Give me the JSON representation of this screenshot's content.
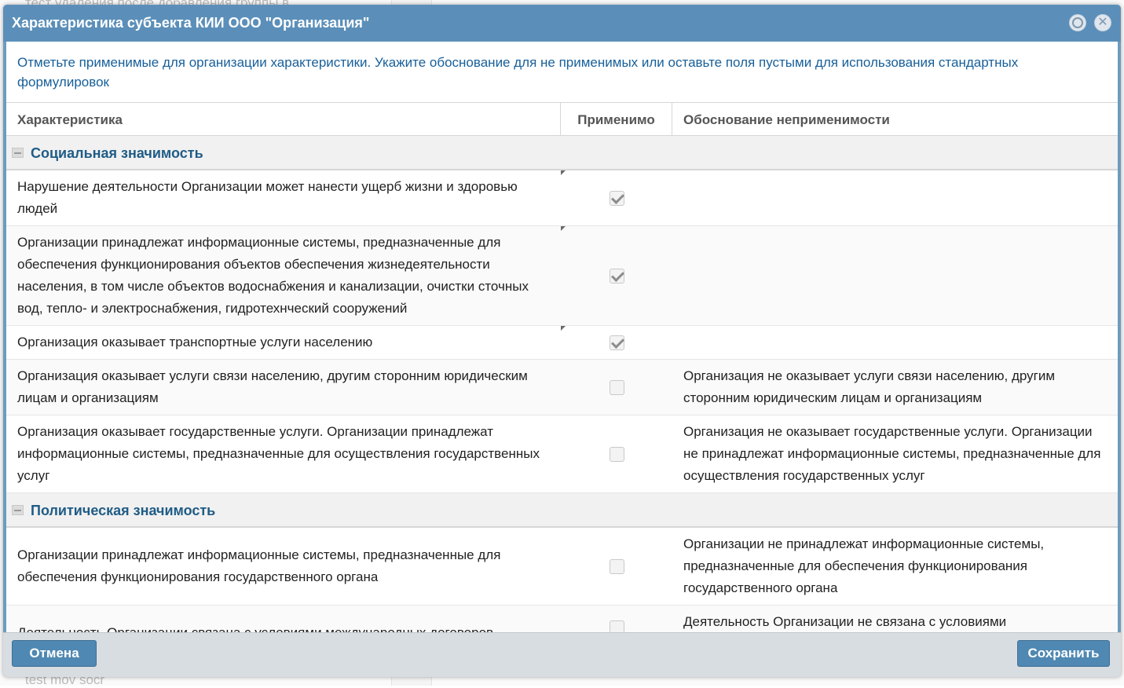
{
  "background": {
    "top_text": "тест удаления после добавления группы в",
    "bottom_text": "test mov socr"
  },
  "dialog": {
    "title": "Характеристика субъекта КИИ ООО \"Организация\"",
    "close_symbol": "✕",
    "hint": "Отметьте применимые для организации характеристики. Укажите обоснование для не применимых или оставьте поля пустыми для использования стандартных формулировок"
  },
  "grid": {
    "columns": [
      "Характеристика",
      "Применимо",
      "Обоснование неприменимости"
    ],
    "groups": [
      {
        "title": "Социальная значимость",
        "rows": [
          {
            "characteristic": "Нарушение деятельности Организации может нанести ущерб жизни и здоровью людей",
            "applicable": true,
            "justification": ""
          },
          {
            "characteristic": "Организации принадлежат информационные системы, предназначенные для обеспечения функционирования объектов обеспечения жизнедеятельности населения, в том числе объектов водоснабжения и канализации, очистки сточных вод, тепло- и электроснабжения, гидротехнческий сооружений",
            "applicable": true,
            "justification": ""
          },
          {
            "characteristic": "Организация оказывает транспортные услуги населению",
            "applicable": true,
            "justification": ""
          },
          {
            "characteristic": "Организация оказывает услуги связи населению, другим сторонним юридическим лицам и организациям",
            "applicable": false,
            "justification": "Организация не оказывает услуги связи населению, другим сторонним юридическим лицам и организациям"
          },
          {
            "characteristic": "Организация оказывает государственные услуги. Организации принадлежат информационные системы, предназначенные для осуществления государственных услуг",
            "applicable": false,
            "justification": "Организация не оказывает государственные услуги. Организации не принадлежат информационные системы, предназначенные для осуществления государственных услуг"
          }
        ]
      },
      {
        "title": "Политическая значимость",
        "rows": [
          {
            "characteristic": "Организации принадлежат информационные системы, предназначенные для обеспечения функционирования государственного органа",
            "applicable": false,
            "justification": "Организации не принадлежат информационные системы, предназначенные для обеспечения функционирования государственного органа"
          },
          {
            "characteristic": "Деятельность Организации связана с условиями международных договоров",
            "applicable": false,
            "justification": "Деятельность Организации не связана с условиями"
          }
        ]
      }
    ]
  },
  "footer": {
    "cancel_label": "Отмена",
    "save_label": "Сохранить"
  },
  "colors": {
    "titlebar": "#5b8fb9",
    "group_title": "#1f5c86",
    "hint": "#18609a",
    "button": "#4f88b2"
  }
}
